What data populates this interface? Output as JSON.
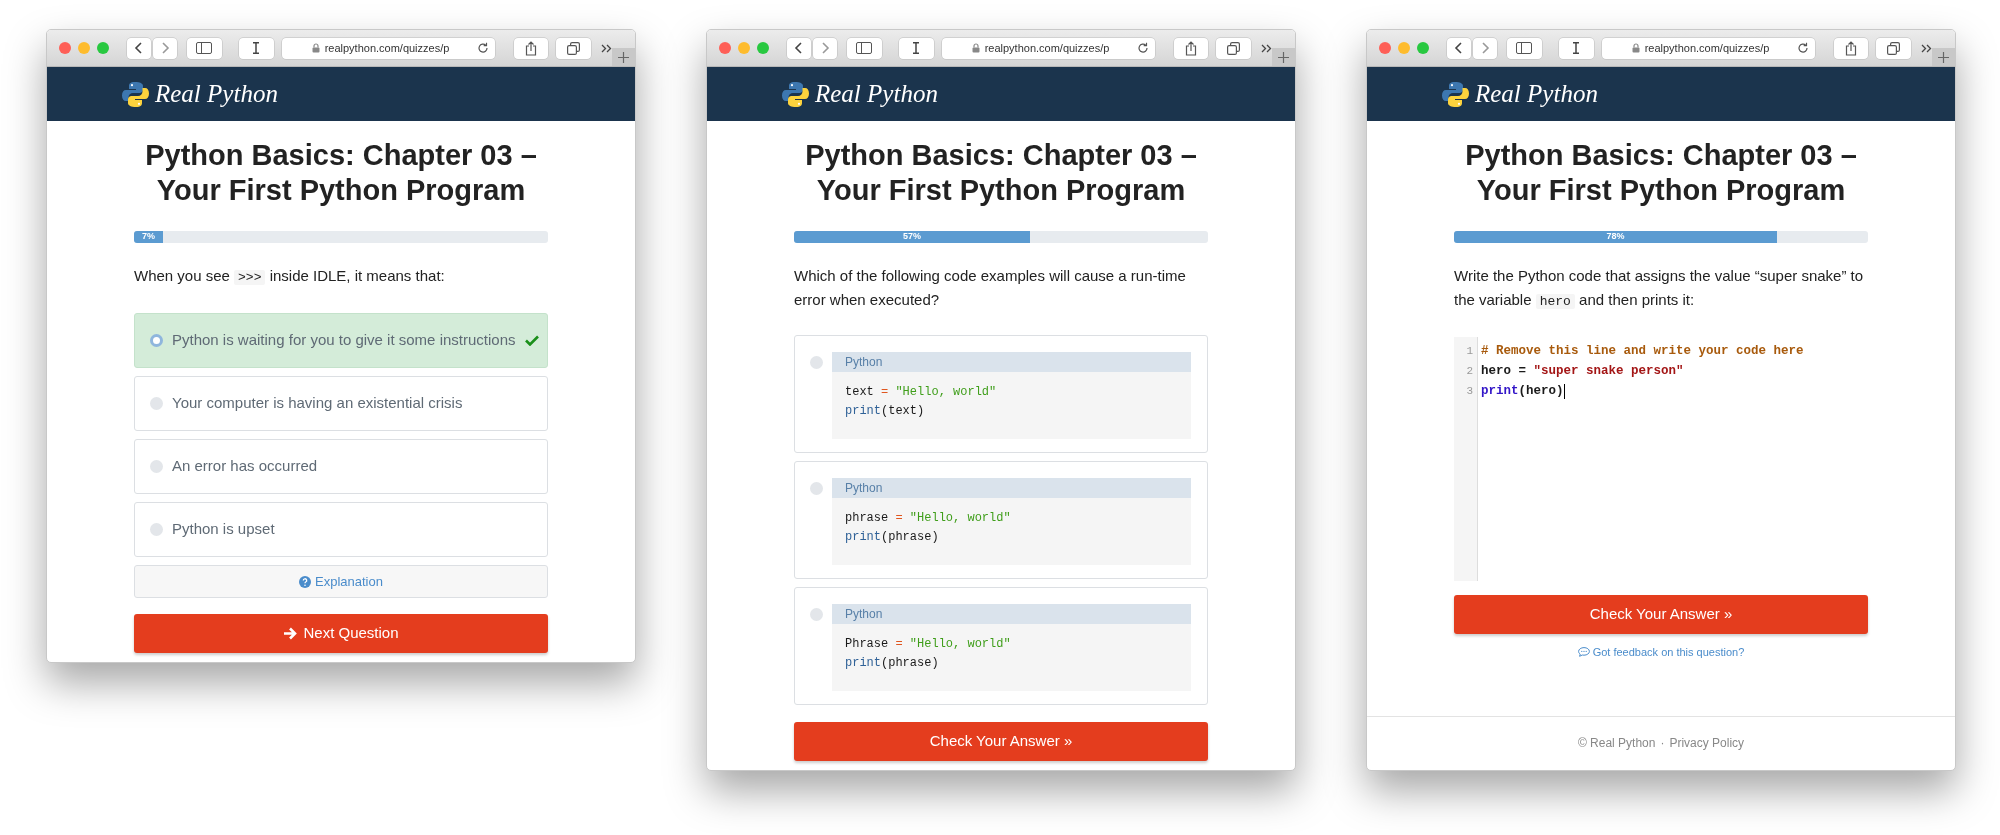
{
  "windows": [
    {
      "url": "realpython.com/quizzes/p",
      "brand": "Real Python",
      "title_lines": [
        "Python Basics: Chapter 03 –",
        "Your First Python Program"
      ],
      "progress": {
        "level": 0.07,
        "label": "7%"
      },
      "question_parts": [
        {
          "kind": "text",
          "text": "When you see "
        },
        {
          "kind": "code",
          "text": ">>>"
        },
        {
          "kind": "text",
          "text": " inside IDLE, it means that:"
        }
      ],
      "options": [
        {
          "kind": "text",
          "text": "Python is waiting for you to give it some instructions",
          "selected": true,
          "correct": true
        },
        {
          "kind": "text",
          "text": "Your computer is having an existential crisis",
          "selected": false,
          "correct": false
        },
        {
          "kind": "text",
          "text": "An error has occurred",
          "selected": false,
          "correct": false
        },
        {
          "kind": "text",
          "text": "Python is upset",
          "selected": false,
          "correct": false
        }
      ],
      "explanation": {
        "label": "Explanation"
      },
      "action_button": {
        "kind": "next",
        "label": "Next Question"
      }
    },
    {
      "url": "realpython.com/quizzes/p",
      "brand": "Real Python",
      "title_lines": [
        "Python Basics: Chapter 03 –",
        "Your First Python Program"
      ],
      "progress": {
        "level": 0.57,
        "label": "57%"
      },
      "question_parts": [
        {
          "kind": "text",
          "text": "Which of the following code examples will cause a run-time error when executed?"
        }
      ],
      "options": [
        {
          "kind": "code",
          "selected": false,
          "language": "Python",
          "lines": [
            [
              {
                "kind": "name",
                "text": "text"
              },
              {
                "kind": "op",
                "text": " = "
              },
              {
                "kind": "string",
                "text": "\"Hello, world\""
              }
            ],
            [
              {
                "kind": "builtin",
                "text": "print"
              },
              {
                "kind": "name",
                "text": "(text)"
              }
            ]
          ]
        },
        {
          "kind": "code",
          "selected": false,
          "language": "Python",
          "lines": [
            [
              {
                "kind": "name",
                "text": "phrase"
              },
              {
                "kind": "op",
                "text": " = "
              },
              {
                "kind": "string",
                "text": "\"Hello, world\""
              }
            ],
            [
              {
                "kind": "builtin",
                "text": "print"
              },
              {
                "kind": "name",
                "text": "(phrase)"
              }
            ]
          ]
        },
        {
          "kind": "code",
          "selected": false,
          "language": "Python",
          "lines": [
            [
              {
                "kind": "name",
                "text": "Phrase"
              },
              {
                "kind": "op",
                "text": " = "
              },
              {
                "kind": "string",
                "text": "\"Hello, world\""
              }
            ],
            [
              {
                "kind": "builtin",
                "text": "print"
              },
              {
                "kind": "name",
                "text": "(phrase)"
              }
            ]
          ]
        }
      ],
      "action_button": {
        "kind": "check",
        "label": "Check Your Answer »"
      }
    },
    {
      "url": "realpython.com/quizzes/p",
      "brand": "Real Python",
      "title_lines": [
        "Python Basics: Chapter 03 –",
        "Your First Python Program"
      ],
      "progress": {
        "level": 0.78,
        "label": "78%"
      },
      "question_parts": [
        {
          "kind": "text",
          "text": "Write the Python code that assigns the value “super snake” to the variable "
        },
        {
          "kind": "code",
          "text": "hero"
        },
        {
          "kind": "text",
          "text": " and then prints it:"
        }
      ],
      "editor": {
        "focused": true,
        "lines": [
          {
            "number": "1",
            "tokens": [
              {
                "kind": "comment",
                "text": "# Remove this line and write your code here"
              }
            ]
          },
          {
            "number": "2",
            "tokens": [
              {
                "kind": "name",
                "text": "hero"
              },
              {
                "kind": "op2",
                "text": " = "
              },
              {
                "kind": "string2",
                "text": "\"super snake person\""
              }
            ]
          },
          {
            "number": "3",
            "tokens": [
              {
                "kind": "builtin2",
                "text": "print"
              },
              {
                "kind": "name",
                "text": "(hero)"
              }
            ]
          }
        ]
      },
      "action_button": {
        "kind": "check",
        "label": "Check Your Answer »"
      },
      "feedback_link": {
        "label": "Got feedback on this question?"
      },
      "footer": {
        "copyright": "© Real Python",
        "separator": "·",
        "link": "Privacy Policy"
      }
    }
  ]
}
